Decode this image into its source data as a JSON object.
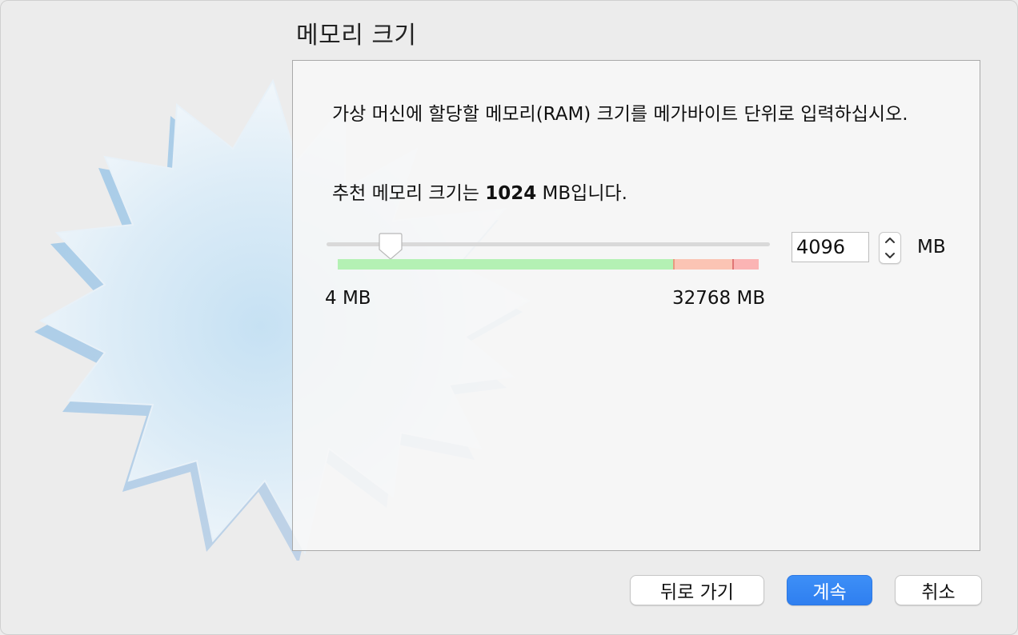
{
  "title": "메모리 크기",
  "description": "가상 머신에 할당할 메모리(RAM) 크기를 메가바이트 단위로 입력하십시오.",
  "recommendation": {
    "prefix": "추천 메모리 크기는 ",
    "value": "1024",
    "suffix": " MB입니다."
  },
  "slider": {
    "min_label": "4 MB",
    "max_label": "32768 MB",
    "current_mb": 4096,
    "min_mb": 4,
    "max_mb": 32768,
    "thumb_fraction": 0.125
  },
  "memory_input": {
    "value": "4096",
    "unit": "MB"
  },
  "buttons": {
    "back": "뒤로 가기",
    "continue": "계속",
    "cancel": "취소"
  },
  "colors": {
    "primary": "#2f7ff0",
    "range_safe": "#b4f1b4",
    "range_warning": "#fbc4b4",
    "range_danger": "#fbb4b4"
  },
  "icons": {
    "watermark": "starburst-icon",
    "slider_thumb": "slider-thumb-icon",
    "stepper_up": "chevron-up-icon",
    "stepper_down": "chevron-down-icon"
  }
}
